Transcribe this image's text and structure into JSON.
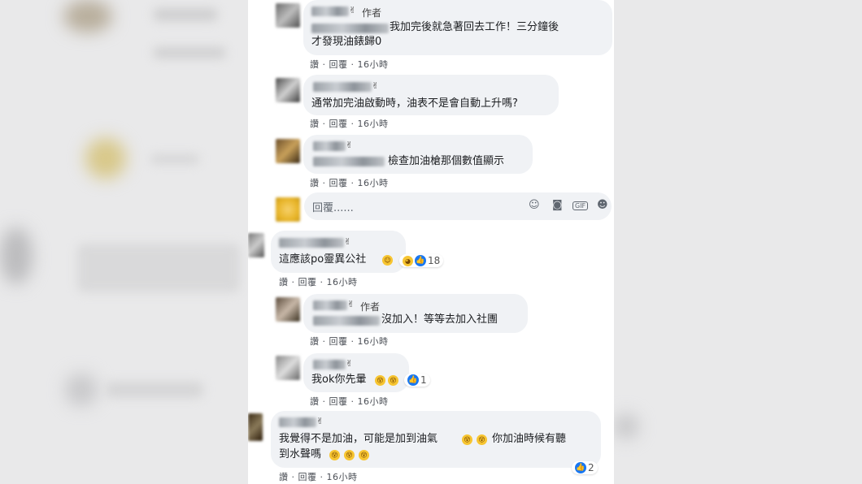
{
  "colors": {
    "like": "#1877f2",
    "bubble": "#f0f2f5",
    "emoji": "#f7c531"
  },
  "comments": [
    {
      "author_badge": "作者",
      "wave": "✌",
      "text": [
        "我加完後就急著回去工作！三分鐘後",
        "才發現油錶歸0"
      ],
      "meta": "讚 · 回覆 · 16小時"
    },
    {
      "wave": "✌",
      "text": [
        "通常加完油啟動時，油表不是會自動上升嗎?"
      ],
      "meta": "讚 · 回覆 · 16小時"
    },
    {
      "wave": "✌",
      "text": [
        "檢查加油槍那個數值顯示"
      ],
      "meta": "讚 · 回覆 · 16小時"
    },
    {
      "wave": "✌",
      "text": [
        "這應該po靈異公社"
      ],
      "reactions": "18",
      "meta": "讚 · 回覆 · 16小時"
    },
    {
      "author_badge": "作者",
      "wave": "✌",
      "text": [
        "沒加入！等等去加入社團"
      ],
      "meta": "讚 · 回覆 · 16小時"
    },
    {
      "wave": "✌",
      "text": [
        "我ok你先暈"
      ],
      "reactions": "1",
      "meta": "讚 · 回覆 · 16小時"
    },
    {
      "wave": "✌",
      "text": [
        "我覺得不是加油，可能是加到油氣",
        "你加油時候有聽",
        "到水聲嗎"
      ],
      "reactions": "2",
      "meta": "讚 · 回覆 · 16小時"
    }
  ],
  "reply_input": {
    "placeholder": "回覆......",
    "icons": [
      "emoji-icon",
      "camera-icon",
      "gif-icon",
      "sticker-icon"
    ],
    "gif": "GIF"
  },
  "emoji": {
    "smile": "☺",
    "laugh": "😆",
    "dizzy": "😵"
  }
}
